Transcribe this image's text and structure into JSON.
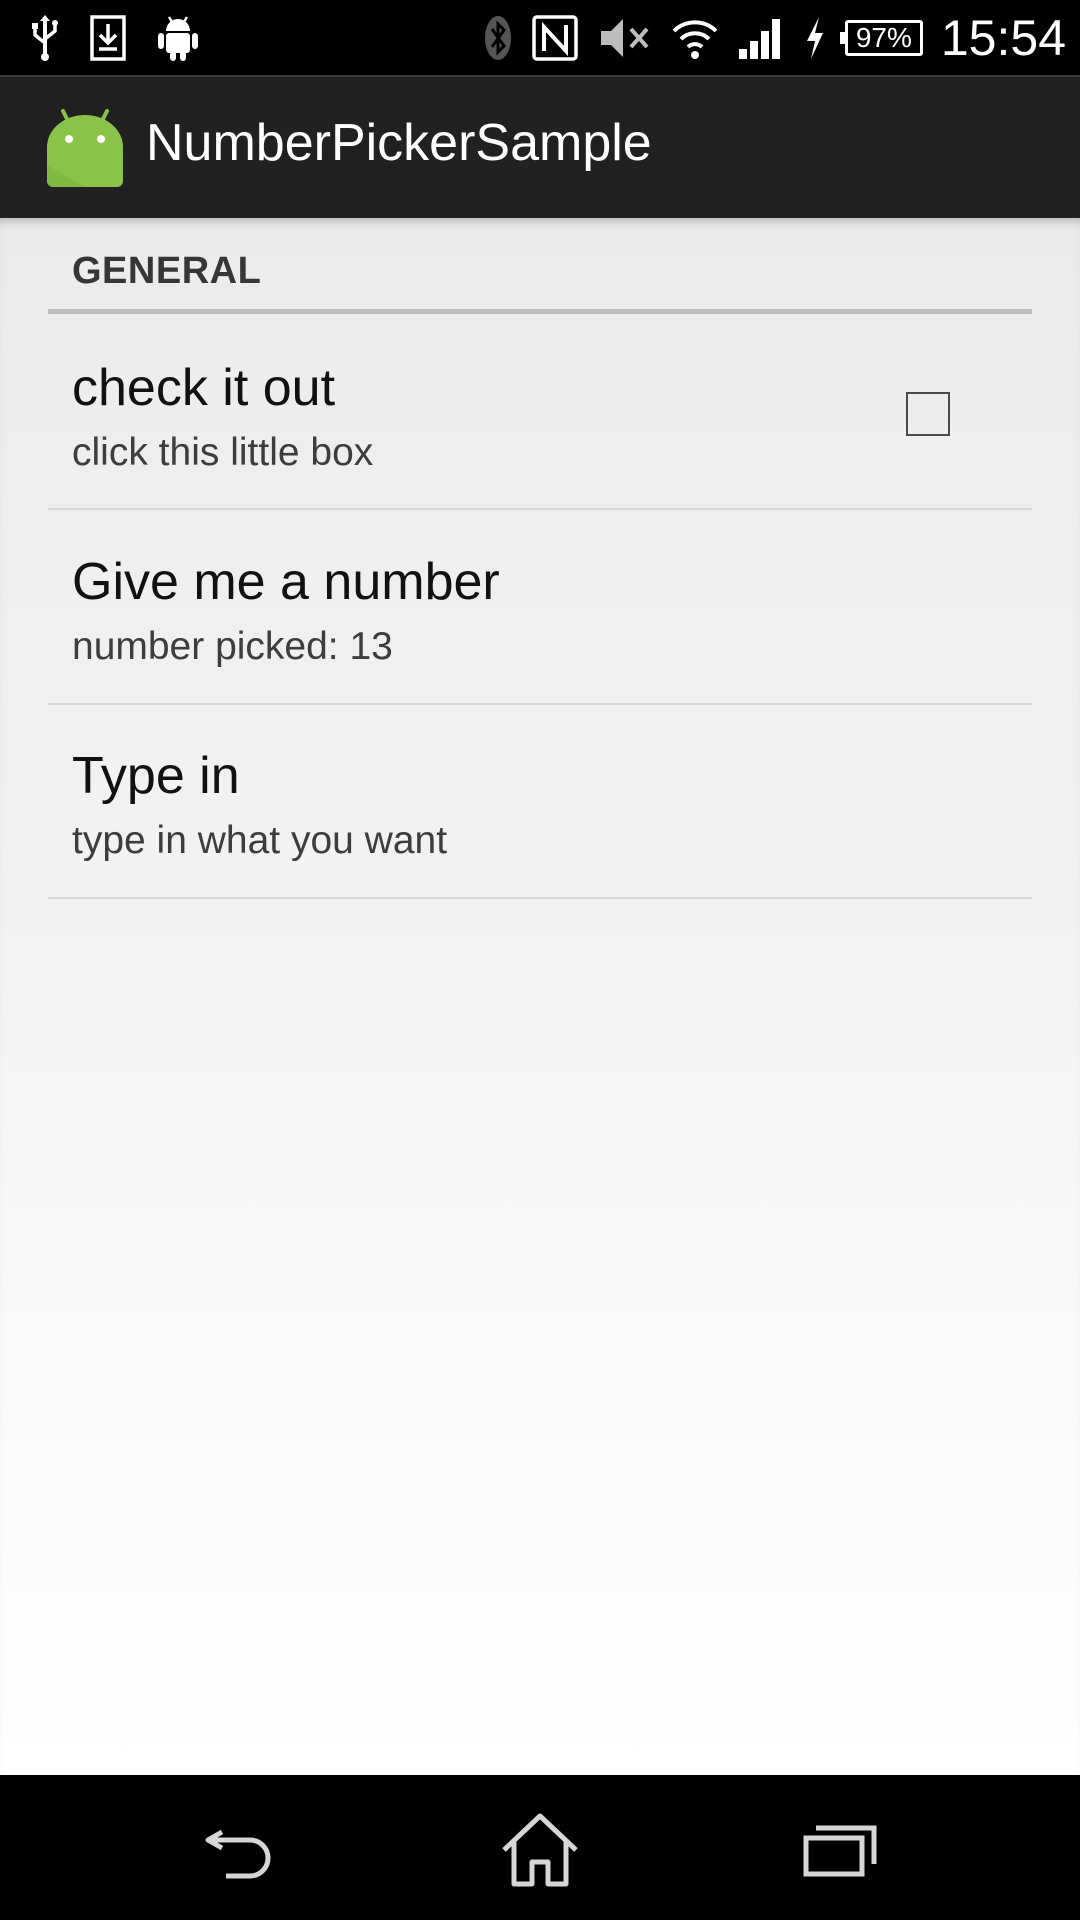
{
  "status_bar": {
    "left_icons": [
      "usb-icon",
      "download-icon",
      "android-debug-icon"
    ],
    "right_icons": [
      "bluetooth-icon",
      "nfc-icon",
      "mute-icon",
      "wifi-icon",
      "signal-icon",
      "charging-icon"
    ],
    "battery": "97%",
    "time": "15:54"
  },
  "action_bar": {
    "icon": "android-logo-icon",
    "title": "NumberPickerSample"
  },
  "preferences": {
    "section_title": "GENERAL",
    "items": [
      {
        "title": "check it out",
        "summary": "click this little box",
        "widget": "checkbox",
        "checked": false
      },
      {
        "title": "Give me a number",
        "summary": "number picked: 13"
      },
      {
        "title": "Type in",
        "summary": "type in what you want"
      }
    ]
  },
  "nav_bar": {
    "buttons": [
      "back-icon",
      "home-icon",
      "recents-icon"
    ]
  },
  "colors": {
    "action_bar_bg": "#212121",
    "app_icon_green": "#8bc34a",
    "content_bg": "#efefef"
  }
}
